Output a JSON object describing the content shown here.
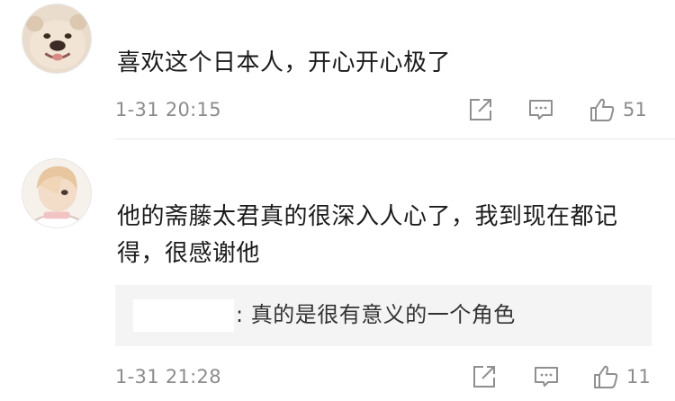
{
  "comments": [
    {
      "avatar": "bulldog-avatar",
      "text": "喜欢这个日本人，开心开心极了",
      "time": "1-31 20:15",
      "likes": "51"
    },
    {
      "avatar": "anime-character-avatar",
      "text": "他的斋藤太君真的很深入人心了，我到现在都记得，很感谢他",
      "time": "1-31 21:28",
      "likes": "11",
      "reply": {
        "text": ": 真的是很有意义的一个角色"
      }
    }
  ],
  "icons": {
    "share": "share-icon",
    "comment": "comment-icon",
    "like": "thumbs-up-icon"
  }
}
